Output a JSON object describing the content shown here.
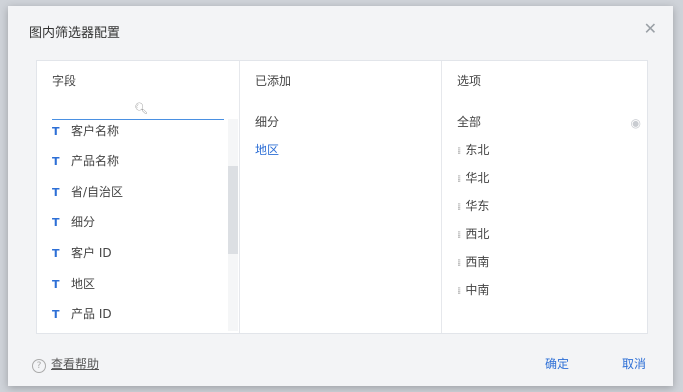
{
  "dialog": {
    "title": "图内筛选器配置",
    "close_icon": "close-icon"
  },
  "fields": {
    "header": "字段",
    "search_placeholder": "",
    "items": [
      {
        "type_icon": "T",
        "label": "客户名称"
      },
      {
        "type_icon": "T",
        "label": "产品名称"
      },
      {
        "type_icon": "T",
        "label": "省/自治区"
      },
      {
        "type_icon": "T",
        "label": "细分"
      },
      {
        "type_icon": "T",
        "label": "客户 ID"
      },
      {
        "type_icon": "T",
        "label": "地区"
      },
      {
        "type_icon": "T",
        "label": "产品 ID"
      }
    ]
  },
  "added": {
    "header": "已添加",
    "items": [
      {
        "label": "细分",
        "color": "#444444"
      },
      {
        "label": "地区",
        "color": "#2d6fd6"
      }
    ]
  },
  "options": {
    "header": "选项",
    "all_label": "全部",
    "items": [
      "东北",
      "华北",
      "华东",
      "西北",
      "西南",
      "中南"
    ]
  },
  "footer": {
    "help_label": "查看帮助",
    "confirm_label": "确定",
    "cancel_label": "取消"
  }
}
